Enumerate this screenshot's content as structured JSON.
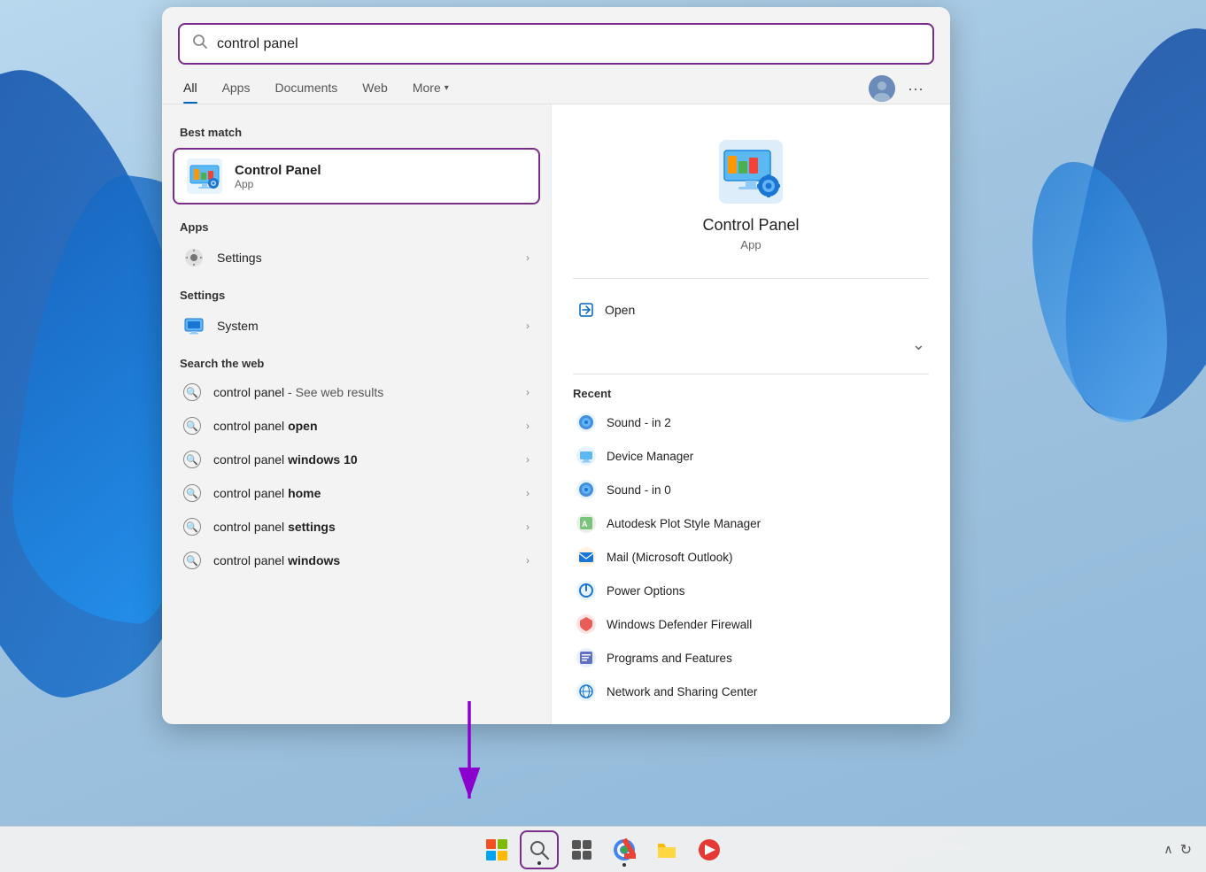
{
  "desktop": {
    "bg_color": "#a8c8e8"
  },
  "search_box": {
    "value": "control panel",
    "placeholder": "Search"
  },
  "tabs": {
    "items": [
      {
        "id": "all",
        "label": "All",
        "active": true
      },
      {
        "id": "apps",
        "label": "Apps",
        "active": false
      },
      {
        "id": "documents",
        "label": "Documents",
        "active": false
      },
      {
        "id": "web",
        "label": "Web",
        "active": false
      },
      {
        "id": "more",
        "label": "More",
        "active": false
      }
    ]
  },
  "best_match": {
    "section_label": "Best match",
    "name": "Control Panel",
    "type": "App"
  },
  "apps_section": {
    "label": "Apps",
    "items": [
      {
        "name": "Settings",
        "has_arrow": true
      }
    ]
  },
  "settings_section": {
    "label": "Settings",
    "items": [
      {
        "name": "System",
        "has_arrow": true
      }
    ]
  },
  "web_section": {
    "label": "Search the web",
    "items": [
      {
        "text_plain": "control panel",
        "text_bold": " - See web results",
        "has_arrow": true
      },
      {
        "text_plain": "control panel ",
        "text_bold": "open",
        "has_arrow": true
      },
      {
        "text_plain": "control panel ",
        "text_bold": "windows 10",
        "has_arrow": true
      },
      {
        "text_plain": "control panel ",
        "text_bold": "home",
        "has_arrow": true
      },
      {
        "text_plain": "control panel ",
        "text_bold": "settings",
        "has_arrow": true
      },
      {
        "text_plain": "control panel ",
        "text_bold": "windows",
        "has_arrow": true
      }
    ]
  },
  "right_panel": {
    "app_name": "Control Panel",
    "app_type": "App",
    "open_label": "Open",
    "recent_label": "Recent",
    "recent_items": [
      {
        "label": "Sound - in 2",
        "icon_type": "globe"
      },
      {
        "label": "Device Manager",
        "icon_type": "device"
      },
      {
        "label": "Sound - in 0",
        "icon_type": "globe"
      },
      {
        "label": "Autodesk Plot Style Manager",
        "icon_type": "autodesk"
      },
      {
        "label": "Mail (Microsoft Outlook)",
        "icon_type": "mail"
      },
      {
        "label": "Power Options",
        "icon_type": "power"
      },
      {
        "label": "Windows Defender Firewall",
        "icon_type": "firewall"
      },
      {
        "label": "Programs and Features",
        "icon_type": "programs"
      },
      {
        "label": "Network and Sharing Center",
        "icon_type": "network"
      }
    ]
  },
  "taskbar": {
    "items": [
      {
        "id": "start",
        "icon": "⊞",
        "label": "Start"
      },
      {
        "id": "search",
        "icon": "🔍",
        "label": "Search"
      },
      {
        "id": "task-view",
        "icon": "▣",
        "label": "Task View"
      },
      {
        "id": "chrome",
        "icon": "◉",
        "label": "Chrome"
      },
      {
        "id": "files",
        "icon": "📁",
        "label": "Files"
      },
      {
        "id": "deliver",
        "icon": "➤",
        "label": "Delivery"
      }
    ],
    "right": {
      "chevron": "∧",
      "refresh": "↻"
    }
  }
}
